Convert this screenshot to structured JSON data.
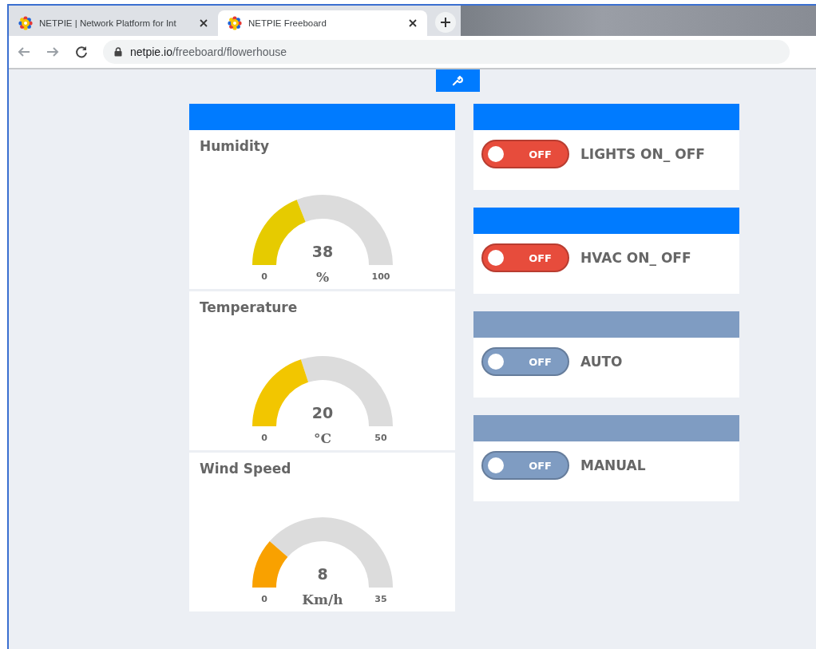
{
  "browser": {
    "tabs": [
      {
        "title": "NETPIE | Network Platform for Int",
        "selected": false
      },
      {
        "title": "NETPIE Freeboard",
        "selected": true
      }
    ],
    "url": {
      "host": "netpie.io",
      "path": "/freeboard/flowerhouse"
    }
  },
  "gauges": [
    {
      "title": "Humidity",
      "value": "38",
      "unit": "%",
      "min": "0",
      "max": "100",
      "color": "#e6cb00"
    },
    {
      "title": "Temperature",
      "value": "20",
      "unit": "°C",
      "min": "0",
      "max": "50",
      "color": "#f2c600"
    },
    {
      "title": "Wind Speed",
      "value": "8",
      "unit": "Km/h",
      "min": "0",
      "max": "35",
      "color": "#f9a100"
    }
  ],
  "switch_panels": [
    {
      "color": "#007bff",
      "switch": {
        "on": false,
        "state_label": "OFF",
        "color": "#e74c3c"
      },
      "label": "LIGHTS ON_ OFF"
    },
    {
      "color": "#007bff",
      "switch": {
        "on": false,
        "state_label": "OFF",
        "color": "#e74c3c"
      },
      "label": "HVAC ON_ OFF"
    },
    {
      "color": "#7f9cc2",
      "switch": {
        "on": false,
        "state_label": "OFF",
        "color": "#7f9cc2"
      },
      "label": "AUTO"
    },
    {
      "color": "#7f9cc2",
      "switch": {
        "on": false,
        "state_label": "OFF",
        "color": "#7f9cc2"
      },
      "label": "MANUAL"
    }
  ]
}
